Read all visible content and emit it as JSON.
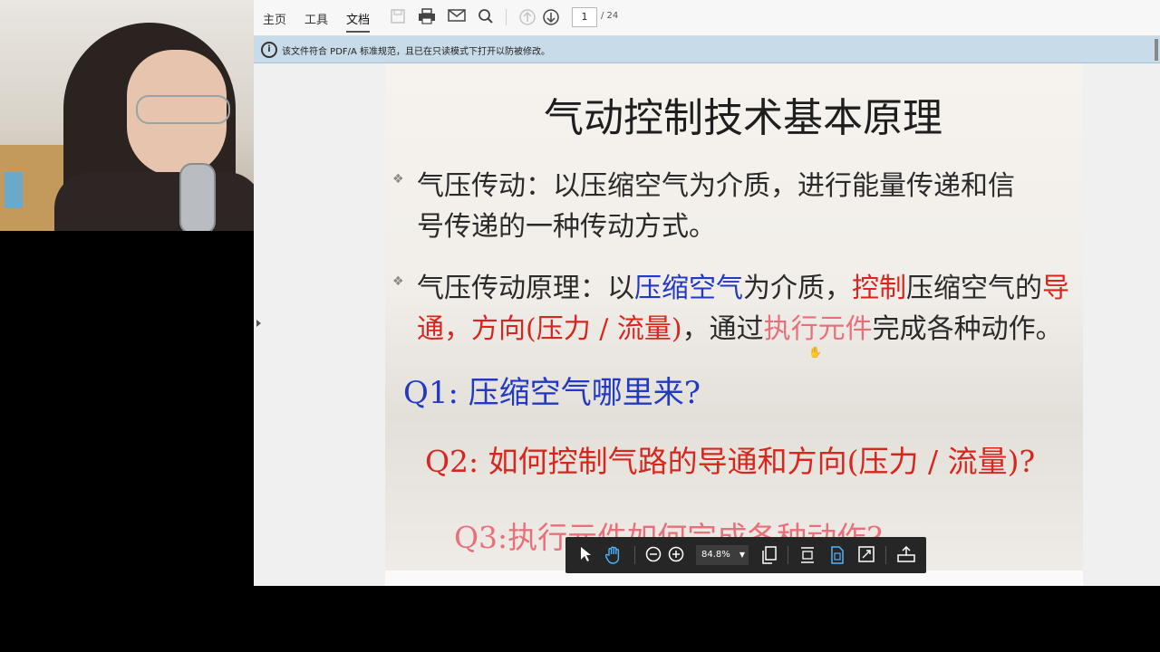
{
  "toolbar": {
    "tabs": [
      {
        "label": "主页"
      },
      {
        "label": "工具"
      },
      {
        "label": "文档"
      }
    ],
    "icons": [
      "save-icon",
      "print-icon",
      "email-icon",
      "search-icon",
      "prev-page-icon",
      "next-page-icon"
    ],
    "page_current": "1",
    "page_total": "/ 24"
  },
  "infobar": {
    "icon": "info-icon",
    "text": "该文件符合 PDF/A 标准规范，且已在只读模式下打开以防被修改。"
  },
  "slide": {
    "title": "气动控制技术基本原理",
    "bullet1_line1": "气压传动：以压缩空气为介质，进行能量传递和信",
    "bullet1_line2": "号传递的一种传动方式。",
    "bullet2_seg1": "气压传动原理：以",
    "bullet2_seg2": "压缩空气",
    "bullet2_seg3": "为介质，",
    "bullet2_seg4": "控制",
    "bullet2_seg5": "压缩空气的",
    "bullet2_seg6": "导",
    "bullet2_line2_seg1": "通，方向(压力 / 流量)",
    "bullet2_line2_seg2": "，通过",
    "bullet2_line2_seg3": "执行元件",
    "bullet2_line2_seg4": "完成各种动作。",
    "q1": "Q1: 压缩空气哪里来?",
    "q2": "Q2: 如何控制气路的导通和方向(压力 / 流量)?",
    "q3": "Q3:执行元件如何完成各种动作?"
  },
  "floating_toolbar": {
    "zoom": "84.8%",
    "icons": [
      "select-cursor-icon",
      "hand-tool-icon",
      "zoom-out-icon",
      "zoom-in-icon",
      "page-thumbnails-icon",
      "fit-width-icon",
      "fit-page-icon",
      "fullscreen-icon",
      "export-icon"
    ]
  },
  "colors": {
    "blue_text": "#2239c4",
    "red_text": "#d8261f",
    "pink_text": "#e7707a",
    "infobar_bg": "#c8dbe9",
    "active_tool": "#4fb3ff"
  }
}
